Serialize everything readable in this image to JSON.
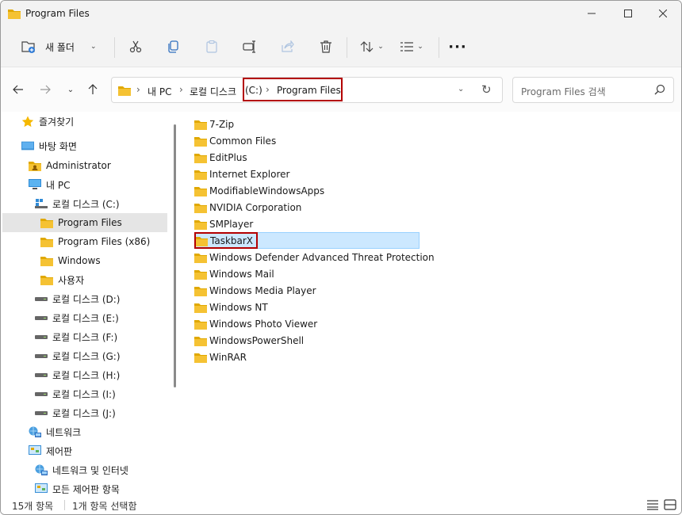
{
  "window": {
    "title": "Program Files"
  },
  "toolbar": {
    "new_folder_label": "새 폴더",
    "icons": [
      "new-folder-icon",
      "cut-icon",
      "copy-icon",
      "paste-icon",
      "rename-icon",
      "share-icon",
      "delete-icon",
      "sort-icon",
      "view-icon",
      "more-icon"
    ]
  },
  "address": {
    "segments": [
      "내 PC",
      "로컬 디스크",
      "(C:)",
      "Program Files"
    ]
  },
  "search": {
    "placeholder": "Program Files 검색"
  },
  "sidebar": {
    "items": [
      {
        "label": "즐겨찾기",
        "icon": "star-icon"
      },
      {
        "label": "바탕 화면",
        "icon": "desktop-icon"
      },
      {
        "label": "Administrator",
        "icon": "user-folder-icon"
      },
      {
        "label": "내 PC",
        "icon": "pc-icon"
      },
      {
        "label": "로컬 디스크 (C:)",
        "icon": "system-drive-icon"
      },
      {
        "label": "Program Files",
        "icon": "folder-icon"
      },
      {
        "label": "Program Files (x86)",
        "icon": "folder-icon"
      },
      {
        "label": "Windows",
        "icon": "folder-icon"
      },
      {
        "label": "사용자",
        "icon": "folder-icon"
      },
      {
        "label": "로컬 디스크 (D:)",
        "icon": "drive-icon"
      },
      {
        "label": "로컬 디스크 (E:)",
        "icon": "drive-icon"
      },
      {
        "label": "로컬 디스크 (F:)",
        "icon": "drive-icon"
      },
      {
        "label": "로컬 디스크 (G:)",
        "icon": "drive-icon"
      },
      {
        "label": "로컬 디스크 (H:)",
        "icon": "drive-icon"
      },
      {
        "label": "로컬 디스크 (I:)",
        "icon": "drive-icon"
      },
      {
        "label": "로컬 디스크 (J:)",
        "icon": "drive-icon"
      },
      {
        "label": "네트워크",
        "icon": "network-icon"
      },
      {
        "label": "제어판",
        "icon": "control-panel-icon"
      },
      {
        "label": "네트워크 및 인터넷",
        "icon": "network-internet-icon"
      },
      {
        "label": "모든 제어판 항목",
        "icon": "control-panel-icon"
      }
    ],
    "selected": "Program Files"
  },
  "files": {
    "items": [
      "7-Zip",
      "Common Files",
      "EditPlus",
      "Internet Explorer",
      "ModifiableWindowsApps",
      "NVIDIA Corporation",
      "SMPlayer",
      "TaskbarX",
      "Windows Defender Advanced Threat Protection",
      "Windows Mail",
      "Windows Media Player",
      "Windows NT",
      "Windows Photo Viewer",
      "WindowsPowerShell",
      "WinRAR"
    ],
    "selected": "TaskbarX"
  },
  "status": {
    "item_count": "15개 항목",
    "selection": "1개 항목 선택함"
  },
  "colors": {
    "folder": "#f5c233",
    "folder_dark": "#e0a800",
    "selection_bg": "#cce8ff",
    "highlight_box": "#b30000",
    "chrome_bg": "#f3f3f3"
  }
}
